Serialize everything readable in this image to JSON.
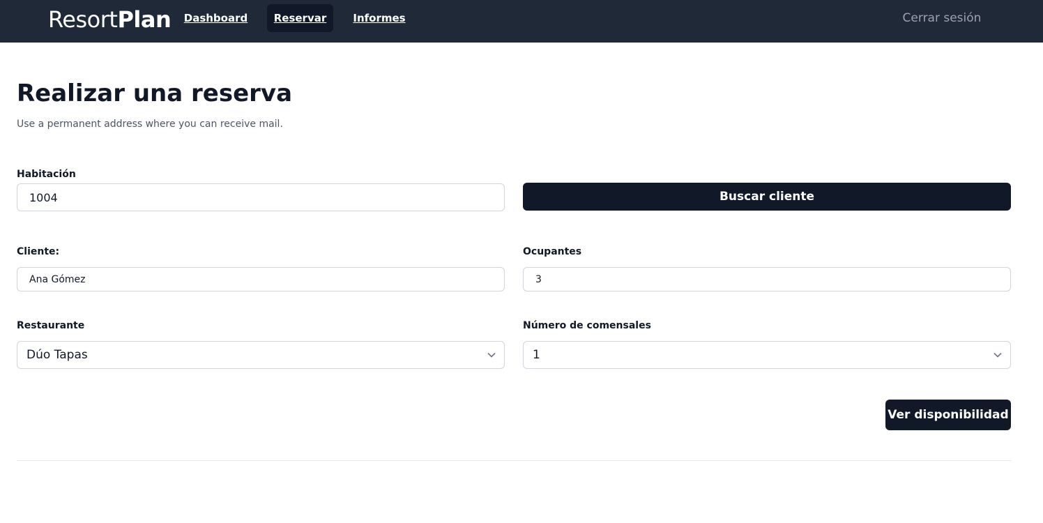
{
  "nav": {
    "brand_light": "Resort",
    "brand_bold": "Plan",
    "links": [
      {
        "label": "Dashboard"
      },
      {
        "label": "Reservar"
      },
      {
        "label": "Informes"
      }
    ],
    "logout_label": "Cerrar sesión"
  },
  "header": {
    "title": "Realizar una reserva",
    "subtitle": "Use a permanent address where you can receive mail."
  },
  "form": {
    "habitacion": {
      "label": "Habitación",
      "value": "1004"
    },
    "buscar_label": "Buscar cliente",
    "cliente": {
      "label": "Cliente:",
      "value": "Ana Gómez"
    },
    "ocupantes": {
      "label": "Ocupantes",
      "value": "3"
    },
    "restaurante": {
      "label": "Restaurante",
      "value": "Dúo Tapas"
    },
    "comensales": {
      "label": "Número de comensales",
      "value": "1"
    },
    "submit_label": "Ver disponibilidad"
  },
  "colors": {
    "navbar_bg": "#1f2937",
    "active_tab_bg": "#111827",
    "primary_button": "#111827"
  }
}
